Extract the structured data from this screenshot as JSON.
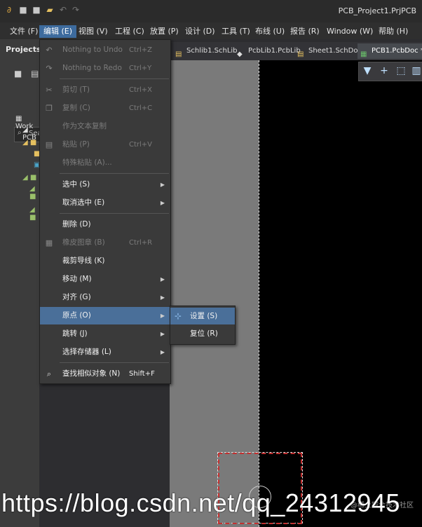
{
  "window": {
    "title": "PCB_Project1.PrjPCB"
  },
  "menubar": [
    {
      "label": "文件 (F)"
    },
    {
      "label": "编辑 (E)"
    },
    {
      "label": "视图 (V)"
    },
    {
      "label": "工程 (C)"
    },
    {
      "label": "放置 (P)"
    },
    {
      "label": "设计 (D)"
    },
    {
      "label": "工具 (T)"
    },
    {
      "label": "布线 (U)"
    },
    {
      "label": "报告 (R)"
    },
    {
      "label": "Window (W)"
    },
    {
      "label": "帮助 (H)"
    }
  ],
  "projects_panel": {
    "title": "Projects",
    "search_placeholder": "Sea",
    "tree": [
      "Work",
      "PCB"
    ]
  },
  "tabs": [
    {
      "label": "Schlib1.SchLib",
      "active": false
    },
    {
      "label": "PcbLib1.PcbLib",
      "active": false
    },
    {
      "label": "Sheet1.SchDoc",
      "active": false
    },
    {
      "label": "PCB1.PcbDoc *",
      "active": true
    }
  ],
  "edit_menu": {
    "items": [
      {
        "label": "Nothing to Undo",
        "shortcut": "Ctrl+Z",
        "icon": "undo-icon",
        "disabled": true
      },
      {
        "label": "Nothing to Redo",
        "shortcut": "Ctrl+Y",
        "icon": "redo-icon",
        "disabled": true
      },
      {
        "label": "剪切 (T)",
        "shortcut": "Ctrl+X",
        "icon": "cut-icon",
        "disabled": true
      },
      {
        "label": "复制 (C)",
        "shortcut": "Ctrl+C",
        "icon": "copy-icon",
        "disabled": true
      },
      {
        "label": "作为文本复制",
        "shortcut": "",
        "icon": "",
        "disabled": true
      },
      {
        "label": "粘贴 (P)",
        "shortcut": "Ctrl+V",
        "icon": "paste-icon",
        "disabled": true
      },
      {
        "label": "特殊粘贴 (A)...",
        "shortcut": "",
        "icon": "",
        "disabled": true
      },
      {
        "label": "选中 (S)",
        "shortcut": "",
        "icon": "",
        "disabled": false,
        "submenu": true
      },
      {
        "label": "取消选中 (E)",
        "shortcut": "",
        "icon": "",
        "disabled": false,
        "submenu": true
      },
      {
        "label": "删除 (D)",
        "shortcut": "",
        "icon": "",
        "disabled": false
      },
      {
        "label": "橡皮图章 (B)",
        "shortcut": "Ctrl+R",
        "icon": "rubber-stamp-icon",
        "disabled": true
      },
      {
        "label": "裁剪导线 (K)",
        "shortcut": "",
        "icon": "",
        "disabled": false
      },
      {
        "label": "移动 (M)",
        "shortcut": "",
        "icon": "",
        "disabled": false,
        "submenu": true
      },
      {
        "label": "对齐 (G)",
        "shortcut": "",
        "icon": "",
        "disabled": false,
        "submenu": true
      },
      {
        "label": "原点 (O)",
        "shortcut": "",
        "icon": "",
        "disabled": false,
        "submenu": true,
        "highlighted": true
      },
      {
        "label": "跳转 (J)",
        "shortcut": "",
        "icon": "",
        "disabled": false,
        "submenu": true
      },
      {
        "label": "选择存储器 (L)",
        "shortcut": "",
        "icon": "",
        "disabled": false,
        "submenu": true
      },
      {
        "label": "查找相似对象 (N)",
        "shortcut": "Shift+F",
        "icon": "find-similar-icon",
        "disabled": false
      }
    ]
  },
  "origin_submenu": {
    "items": [
      {
        "label": "设置 (S)",
        "highlighted": true,
        "icon": "set-origin-icon"
      },
      {
        "label": "复位 (R)",
        "highlighted": false,
        "icon": ""
      }
    ]
  },
  "watermarks": {
    "small": "@稀土掘金技术社区",
    "url": "https://blog.csdn.net/qq_24312945"
  }
}
